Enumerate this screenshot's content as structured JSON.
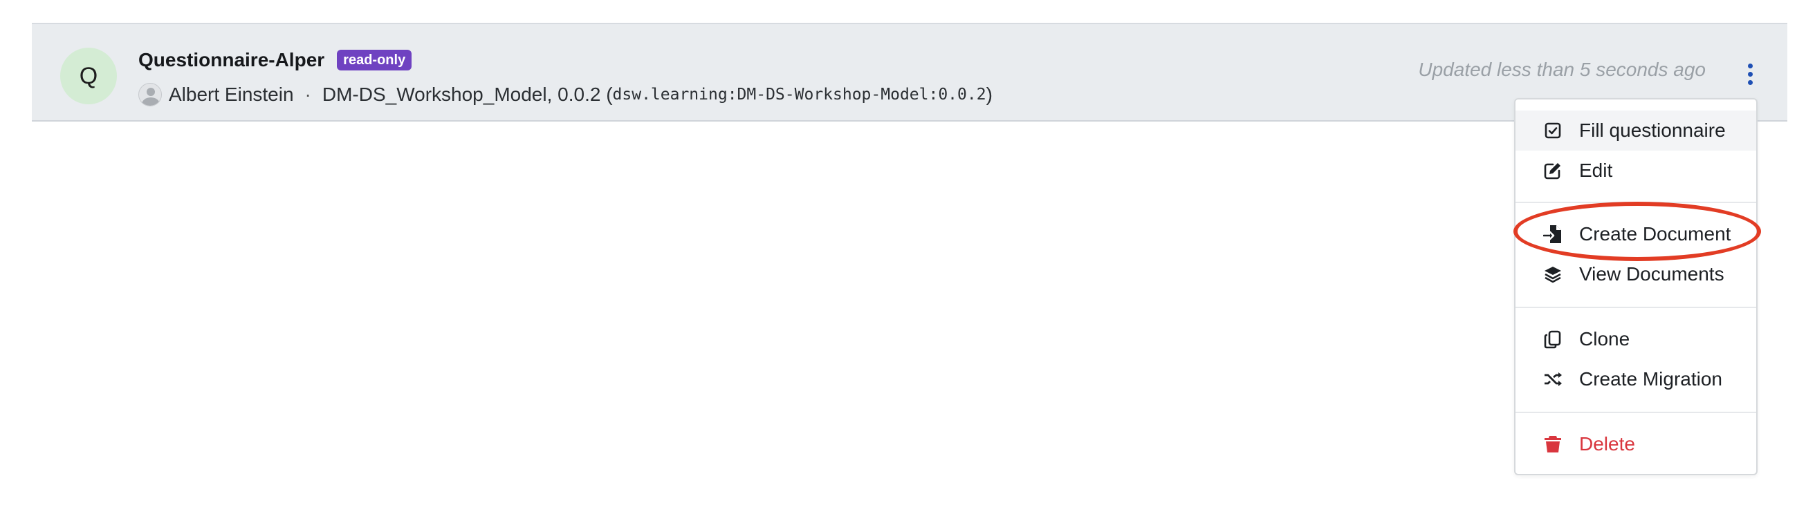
{
  "item": {
    "avatar_letter": "Q",
    "title": "Questionnaire-Alper",
    "badge": "read-only",
    "owner": "Albert Einstein",
    "separator": "·",
    "package_name": "DM-DS_Workshop_Model, 0.0.2",
    "package_id_open": " (",
    "package_id": "dsw.learning:DM-DS-Workshop-Model:0.0.2",
    "package_id_close": ")",
    "updated": "Updated less than 5 seconds ago"
  },
  "menu": {
    "fill": "Fill questionnaire",
    "edit": "Edit",
    "create_document": "Create Document",
    "view_documents": "View Documents",
    "clone": "Clone",
    "create_migration": "Create Migration",
    "delete": "Delete"
  },
  "colors": {
    "badge": "#6f42c1",
    "kebab": "#1e4fb4",
    "danger": "#d9363e",
    "annotation": "#e23c24"
  }
}
